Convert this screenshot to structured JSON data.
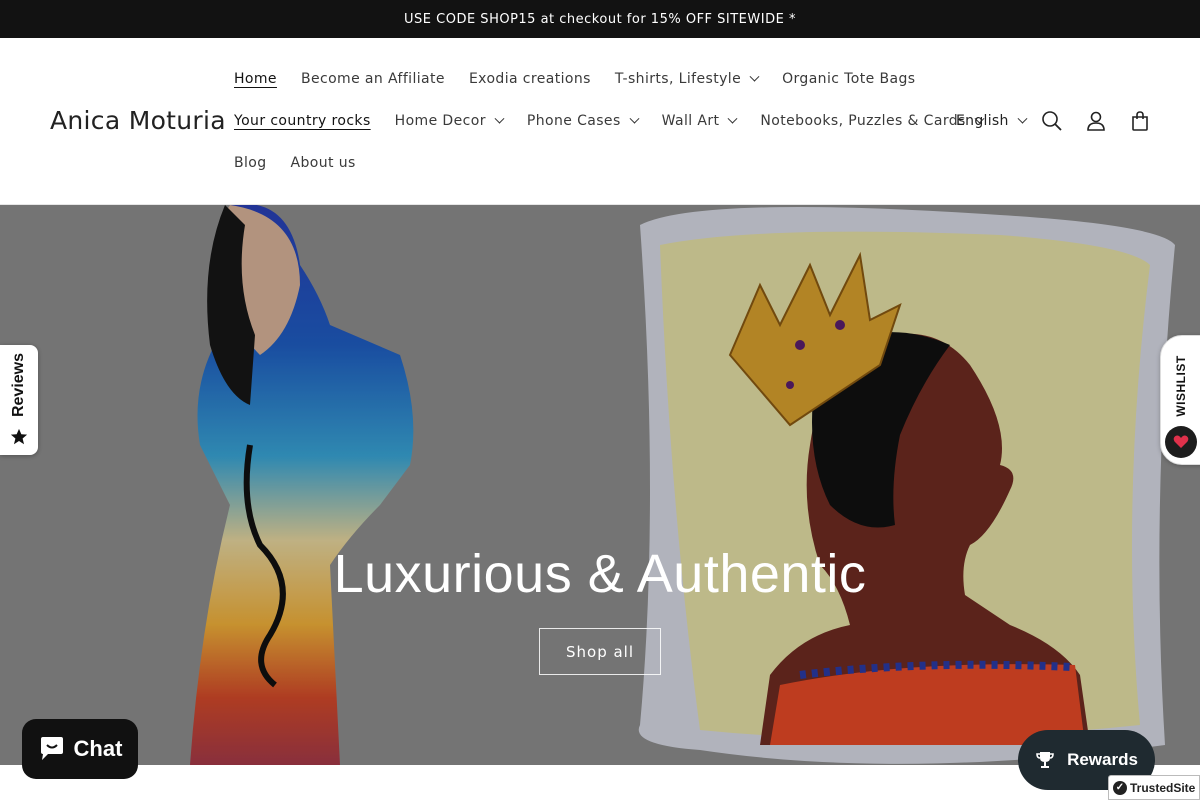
{
  "announcement": "USE CODE SHOP15 at checkout for 15% OFF SITEWIDE *",
  "brand": {
    "name": "Anica Moturia"
  },
  "nav": {
    "row1": [
      {
        "label": "Home",
        "active": true,
        "dropdown": false
      },
      {
        "label": "Become an Affiliate",
        "dropdown": false
      },
      {
        "label": "Exodia creations",
        "dropdown": false
      },
      {
        "label": "T-shirts, Lifestyle",
        "dropdown": true
      },
      {
        "label": "Organic Tote Bags",
        "dropdown": false
      }
    ],
    "row2": [
      {
        "label": "Your country rocks",
        "active": true,
        "dropdown": false
      },
      {
        "label": "Home Decor",
        "dropdown": true
      },
      {
        "label": "Phone Cases",
        "dropdown": true
      },
      {
        "label": "Wall Art",
        "dropdown": true
      },
      {
        "label": "Notebooks, Puzzles & Cards",
        "dropdown": true
      }
    ],
    "row3": [
      {
        "label": "Blog",
        "dropdown": false
      },
      {
        "label": "About us",
        "dropdown": false
      }
    ]
  },
  "header_actions": {
    "language": "English",
    "icons": [
      "search-icon",
      "account-icon",
      "cart-icon"
    ]
  },
  "hero": {
    "title": "Luxurious & Authentic",
    "cta": "Shop all"
  },
  "widgets": {
    "reviews_label": "Reviews",
    "wishlist_label": "WISHLIST",
    "chat_label": "Chat",
    "rewards_label": "Rewards",
    "trusted_label": "TrustedSite"
  },
  "colors": {
    "announcement_bg": "#121212",
    "chat_bg": "#111111",
    "rewards_bg": "#1f2a30",
    "wishlist_heart": "#e0314b"
  }
}
